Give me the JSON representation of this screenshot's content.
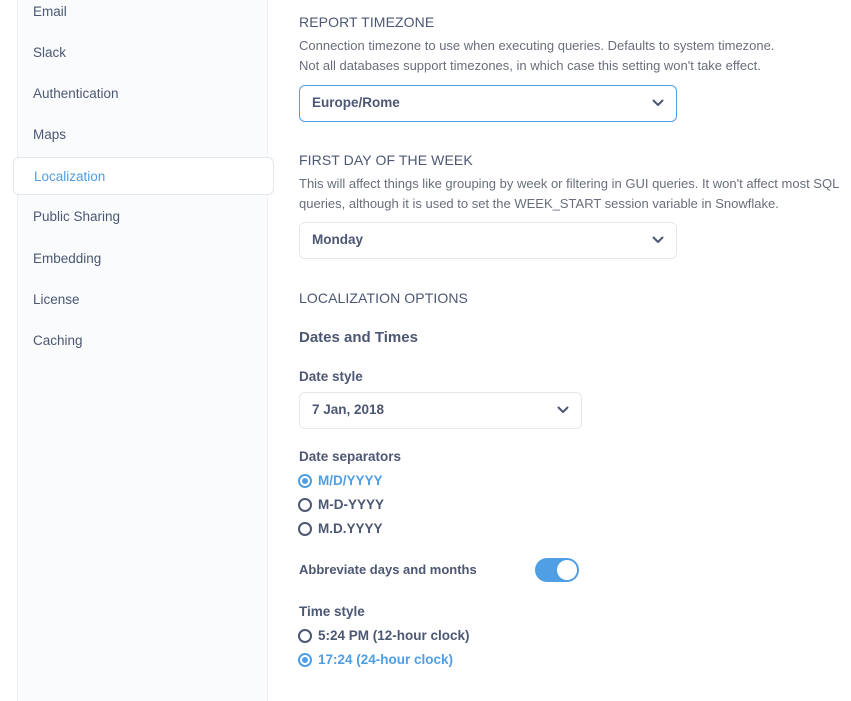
{
  "sidebar": {
    "items": [
      {
        "label": "Email"
      },
      {
        "label": "Slack"
      },
      {
        "label": "Authentication"
      },
      {
        "label": "Maps"
      },
      {
        "label": "Localization"
      },
      {
        "label": "Public Sharing"
      },
      {
        "label": "Embedding"
      },
      {
        "label": "License"
      },
      {
        "label": "Caching"
      }
    ],
    "active_index": 4
  },
  "report_timezone": {
    "title": "REPORT TIMEZONE",
    "desc_line1": "Connection timezone to use when executing queries. Defaults to system timezone.",
    "desc_line2": "Not all databases support timezones, in which case this setting won't take effect.",
    "value": "Europe/Rome"
  },
  "first_day": {
    "title": "FIRST DAY OF THE WEEK",
    "desc_line1": "This will affect things like grouping by week or filtering in GUI queries. It won't affect most SQL",
    "desc_line2": "queries, although it is used to set the WEEK_START session variable in Snowflake.",
    "value": "Monday"
  },
  "localization": {
    "title": "LOCALIZATION OPTIONS",
    "subtitle": "Dates and Times",
    "date_style_label": "Date style",
    "date_style_value": "7 Jan, 2018",
    "separators_label": "Date separators",
    "separators": [
      {
        "label": "M/D/YYYY",
        "selected": true
      },
      {
        "label": "M-D-YYYY",
        "selected": false
      },
      {
        "label": "M.D.YYYY",
        "selected": false
      }
    ],
    "abbreviate_label": "Abbreviate days and months",
    "abbreviate_on": true,
    "time_style_label": "Time style",
    "time_styles": [
      {
        "label": "5:24 PM (12-hour clock)",
        "selected": false
      },
      {
        "label": "17:24 (24-hour clock)",
        "selected": true
      }
    ]
  },
  "colors": {
    "accent": "#509ee3",
    "text": "#4c5773",
    "muted": "#696e7b"
  }
}
